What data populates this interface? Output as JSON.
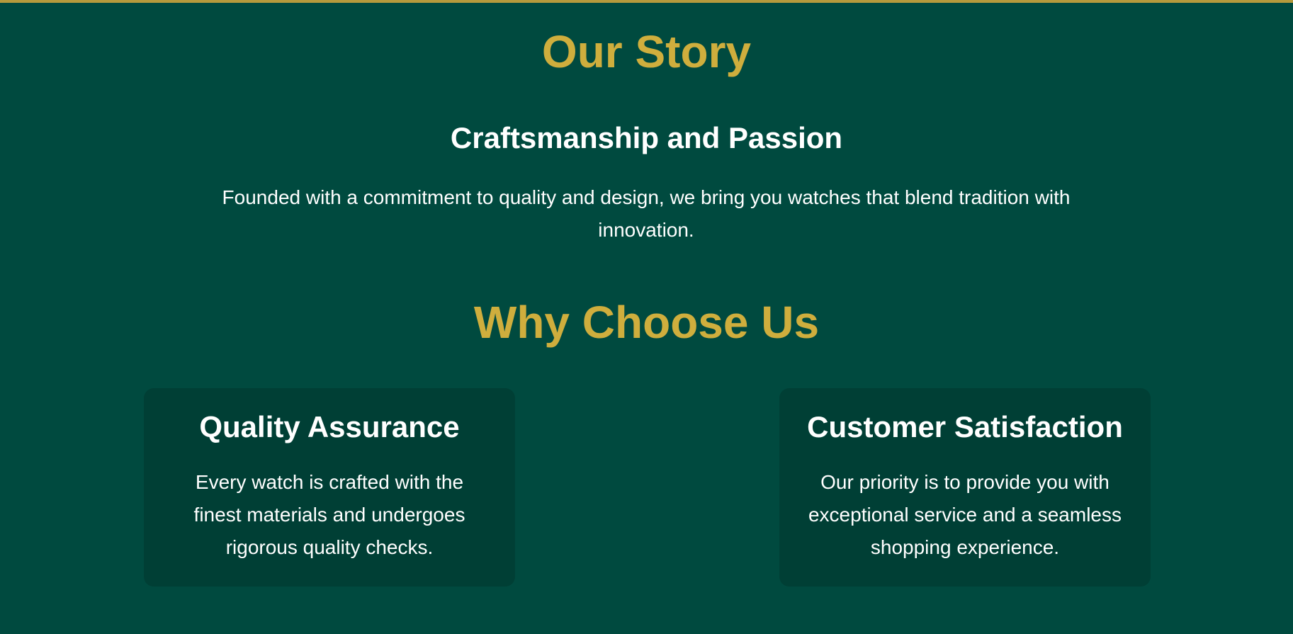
{
  "story": {
    "title": "Our Story",
    "subtitle": "Craftsmanship and Passion",
    "body": "Founded with a commitment to quality and design, we bring you watches that blend tradition with innovation."
  },
  "why": {
    "title": "Why Choose Us",
    "cards": [
      {
        "title": "Quality Assurance",
        "text": "Every watch is crafted with the finest materials and undergoes rigorous quality checks."
      },
      {
        "title": "Customer Satisfaction",
        "text": "Our priority is to provide you with exceptional service and a seamless shopping experience."
      }
    ]
  },
  "colors": {
    "background": "#004a3f",
    "card_background": "#003f35",
    "accent_gold": "#cfae3d",
    "text": "#ffffff"
  }
}
